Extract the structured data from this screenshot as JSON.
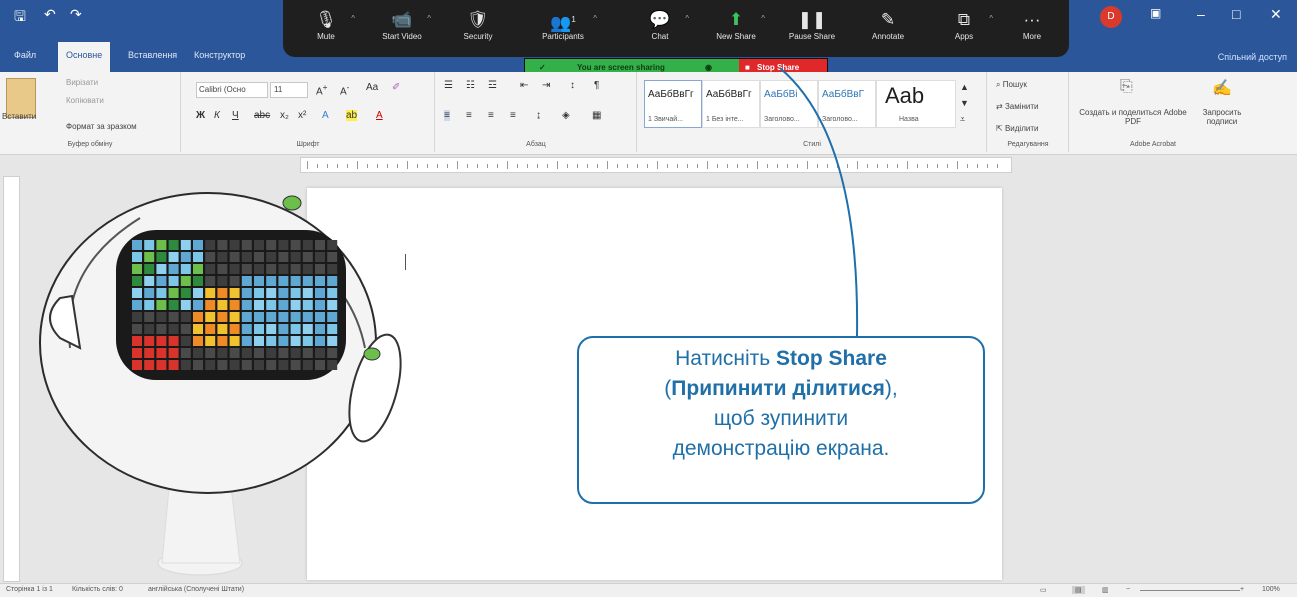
{
  "app": {
    "qat": {
      "save": "🖫",
      "undo": "↶",
      "redo": "↷"
    },
    "tabs": [
      "Файл",
      "Основне",
      "Вставлення",
      "Конструктор"
    ],
    "share_access": "Спільний доступ",
    "window_controls": {
      "minimize": "–",
      "restore": "□",
      "close": "✕"
    }
  },
  "zoom_toolbar": {
    "buttons": [
      {
        "label": "Mute",
        "icon": "🎙"
      },
      {
        "label": "Start Video",
        "icon": "📹"
      },
      {
        "label": "Security",
        "icon": "🛡"
      },
      {
        "label": "Participants",
        "icon": "👥",
        "count": "1"
      },
      {
        "label": "Chat",
        "icon": "💬"
      },
      {
        "label": "New Share",
        "icon": "⬆"
      },
      {
        "label": "Pause Share",
        "icon": "❚❚"
      },
      {
        "label": "Annotate",
        "icon": "✎"
      },
      {
        "label": "Apps",
        "icon": "⧉"
      },
      {
        "label": "More",
        "icon": "···"
      }
    ],
    "sharing_status": "You are screen sharing",
    "stop_share": "Stop Share"
  },
  "ribbon": {
    "clipboard": {
      "paste": "Вставити",
      "cut": "Вирізати",
      "copy": "Копіювати",
      "format_painter": "Формат за зразком",
      "group": "Буфер обміну"
    },
    "font": {
      "font_name": "Calibri (Осно",
      "font_size": "11",
      "group": "Шрифт"
    },
    "paragraph": {
      "group": "Абзац"
    },
    "styles": {
      "items": [
        {
          "preview": "АаБбВвГг",
          "name": "1 Звичай..."
        },
        {
          "preview": "АаБбВвГг",
          "name": "1 Без інте..."
        },
        {
          "preview": "АаБбВі",
          "name": "Заголово..."
        },
        {
          "preview": "АаБбВвГ",
          "name": "Заголово..."
        },
        {
          "preview": "Aab",
          "name": "Назва"
        }
      ],
      "group": "Стилі"
    },
    "editing": {
      "find": "Пошук",
      "replace": "Замінити",
      "select": "Виділити",
      "group": "Редагування"
    },
    "acrobat": {
      "create": "Создать и поделиться Adobe PDF",
      "request": "Запросить подписи",
      "group": "Adobe Acrobat"
    }
  },
  "statusbar": {
    "page": "Сторінка 1 із 1",
    "words": "Кількість слів: 0",
    "language": "англійська (Сполучені Штати)",
    "zoom": "100%"
  },
  "callout": {
    "line1_prefix": "Натисніть ",
    "line1_bold": "Stop Share",
    "line2_bold": "Припинити ділитися",
    "line3": "щоб зупинити",
    "line4": "демонстрацію екрана."
  },
  "colors": {
    "word_blue": "#2b579a",
    "zoom_dark": "#1f1f1f",
    "green": "#33b04a",
    "red": "#e0282b",
    "callout": "#1e6fab"
  }
}
